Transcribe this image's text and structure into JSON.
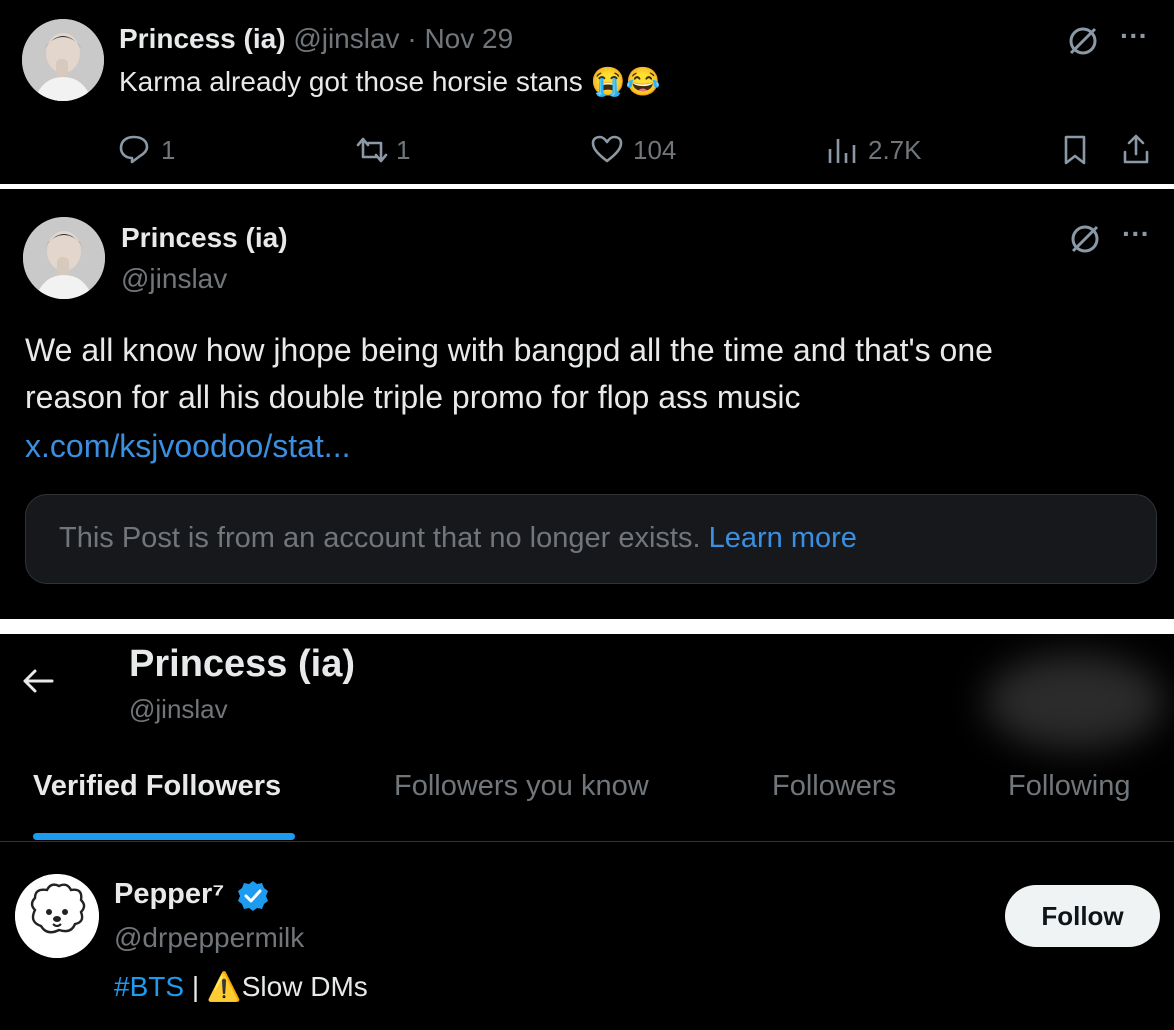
{
  "tweet1": {
    "display_name": "Princess (ia)",
    "handle": "@jinslav",
    "separator": "·",
    "date": "Nov 29",
    "text": "Karma already got those horsie stans",
    "emoji": "😭😂",
    "replies": "1",
    "reposts": "1",
    "likes": "104",
    "views": "2.7K",
    "more": "···"
  },
  "tweet2": {
    "display_name": "Princess (ia)",
    "handle": "@jinslav",
    "text_line1": "We all know how jhope being with bangpd all the time and that's one",
    "text_line2": "reason for all his double triple promo for flop ass music",
    "link": "x.com/ksjvoodoo/stat...",
    "deleted_notice": "This Post is from an account that no longer exists.",
    "learn_more": "Learn more",
    "more": "···"
  },
  "profile": {
    "title": "Princess (ia)",
    "handle": "@jinslav",
    "tabs": [
      "Verified Followers",
      "Followers you know",
      "Followers",
      "Following"
    ],
    "active_tab": 0
  },
  "follower": {
    "display_name": "Pepper⁷",
    "handle": "@drpeppermilk",
    "bio_hashtag": "#BTS",
    "bio_sep": "|",
    "bio_warn": "⚠️",
    "bio_text": "Slow DMs",
    "follow_label": "Follow"
  },
  "colors": {
    "background": "#000000",
    "text": "#e7e9ea",
    "muted": "#71767b",
    "accent": "#1d9bf0",
    "link": "#3a8fe0"
  },
  "icons": [
    "grok-slash-icon",
    "more-icon",
    "reply-icon",
    "repost-icon",
    "like-icon",
    "views-icon",
    "bookmark-icon",
    "share-icon",
    "back-arrow-icon",
    "verified-badge-icon",
    "warning-icon"
  ]
}
